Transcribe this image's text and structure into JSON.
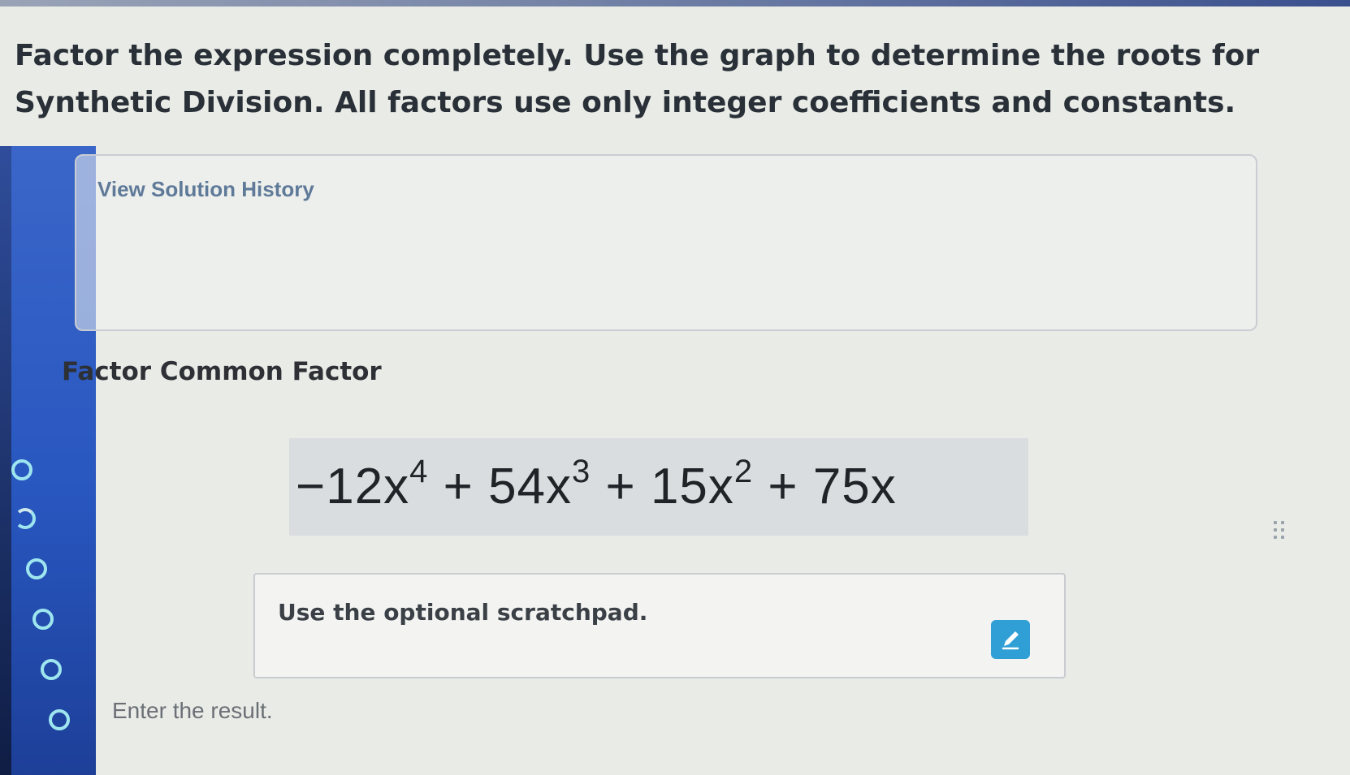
{
  "question": {
    "prompt": "Factor the expression completely. Use the graph to determine the roots for Synthetic Division. All factors use only integer coefficients and constants."
  },
  "solution_history": {
    "link_label": "View Solution History"
  },
  "step": {
    "title": "Factor Common Factor",
    "expression": {
      "t1_coef": "−12x",
      "t1_exp": "4",
      "t2_coef": " + 54x",
      "t2_exp": "3",
      "t3_coef": " + 15x",
      "t3_exp": "2",
      "t4": " + 75x"
    }
  },
  "scratchpad": {
    "label": "Use the optional scratchpad."
  },
  "result": {
    "prompt": "Enter the result."
  },
  "step_indicators": {
    "count": 6,
    "color": "#9ee6ef"
  },
  "colors": {
    "accent": "#2f9fd6",
    "rail": "#2857c0"
  },
  "icons": {
    "pencil": "pencil-icon",
    "drag": "drag-handle-icon"
  }
}
